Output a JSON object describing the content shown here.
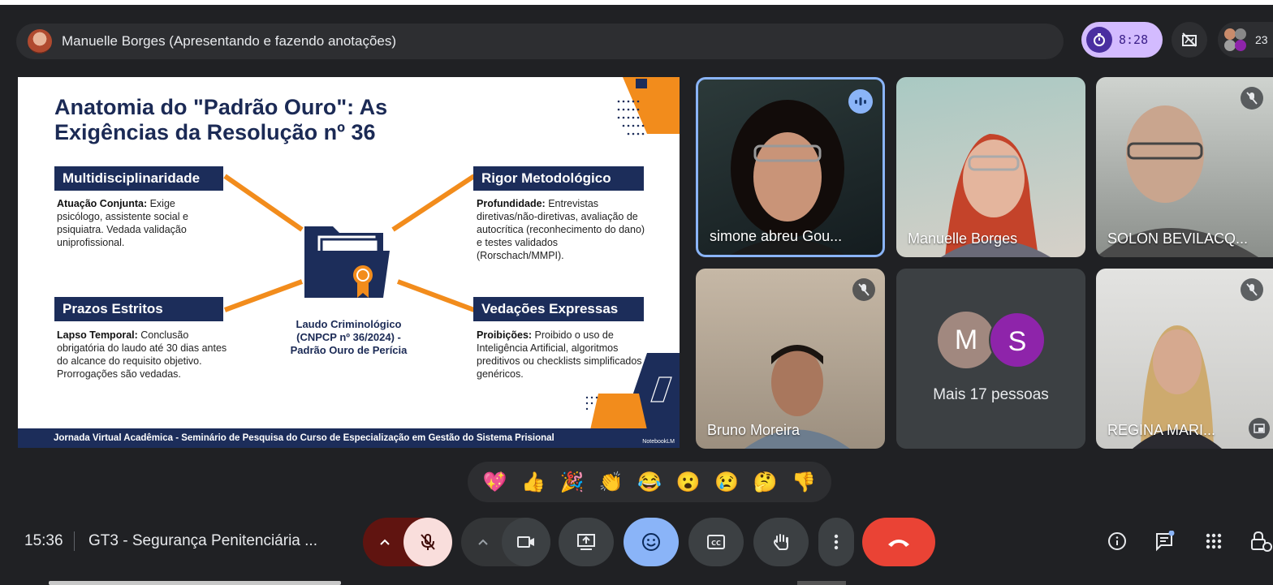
{
  "presenter_bar": {
    "text": "Manuelle Borges (Apresentando e fazendo anotações)"
  },
  "timer": {
    "value": "8:28"
  },
  "participants_count": "23",
  "slide": {
    "title": "Anatomia do \"Padrão Ouro\": As Exigências da Resolução nº 36",
    "sections": [
      {
        "heading": "Multidisciplinaridade",
        "lead": "Atuação Conjunta:",
        "body": " Exige psicólogo, assistente social e psiquiatra. Vedada validação uniprofissional."
      },
      {
        "heading": "Rigor Metodológico",
        "lead": "Profundidade:",
        "body": " Entrevistas diretivas/não-diretivas, avaliação de autocrítica (reconhecimento do dano) e testes validados (Rorschach/MMPI)."
      },
      {
        "heading": "Prazos Estritos",
        "lead": "Lapso Temporal:",
        "body": " Conclusão obrigatória do laudo até 30 dias antes do alcance do requisito objetivo. Prorrogações são vedadas."
      },
      {
        "heading": "Vedações Expressas",
        "lead": "Proibições:",
        "body": " Proibido o uso de Inteligência Artificial, algoritmos preditivos ou checklists simplificados genéricos."
      }
    ],
    "center_caption": "Laudo Criminológico (CNPCP nº 36/2024) - Padrão Ouro de Perícia",
    "footer": "Jornada Virtual Acadêmica - Seminário de Pesquisa do Curso de Especialização em Gestão do Sistema Prisional",
    "brand": "NotebookLM"
  },
  "tiles": [
    {
      "name": "simone abreu Gou...",
      "state": "speaking"
    },
    {
      "name": "Manuelle Borges",
      "state": "unmuted"
    },
    {
      "name": "SOLON BEVILACQ...",
      "state": "muted"
    },
    {
      "name": "Bruno Moreira",
      "state": "muted"
    },
    {
      "name": "Mais 17 pessoas",
      "state": "overflow",
      "avatars": [
        "M",
        "S"
      ]
    },
    {
      "name": "REGINA MARI...",
      "state": "muted"
    }
  ],
  "reactions": [
    "💖",
    "👍",
    "🎉",
    "👏",
    "😂",
    "😮",
    "😢",
    "🤔",
    "👎"
  ],
  "meeting": {
    "time": "15:36",
    "title": "GT3 - Segurança Penitenciária ..."
  },
  "colors": {
    "accent": "#8ab4f8",
    "end_call": "#ea4335",
    "slide_navy": "#1c2d5a",
    "slide_orange": "#f28c1c"
  }
}
